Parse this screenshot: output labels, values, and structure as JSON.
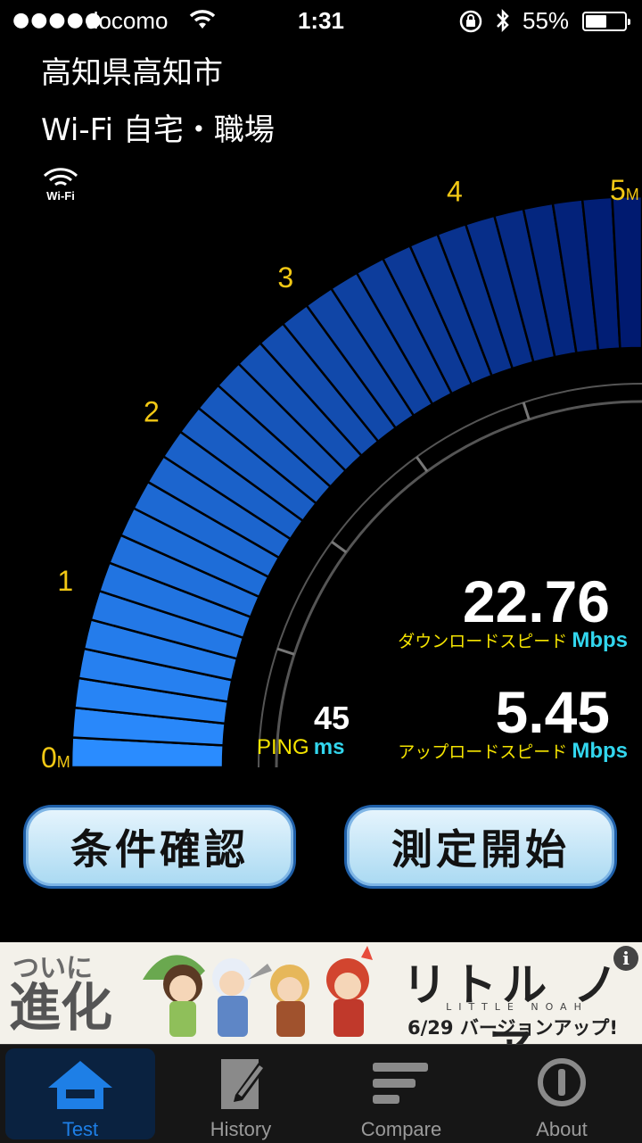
{
  "status_bar": {
    "carrier": "docomo",
    "signal_dots": "●●●●●",
    "time": "1:31",
    "battery_percent": "55%",
    "battery_level": 0.55
  },
  "location": "高知県高知市",
  "connection": "Wi-Fi 自宅・職場",
  "wifi_badge_label": "Wi-Fi",
  "gauge": {
    "scale_labels": [
      "0",
      "1",
      "2",
      "3",
      "4",
      "5"
    ],
    "unit_suffix": "M",
    "needle_value_mbps": 5,
    "max_mbps": 5,
    "color_light": "#2a8cff",
    "color_dark": "#001a70"
  },
  "results": {
    "download_value": "22.76",
    "download_label": "ダウンロードスピード",
    "download_unit": "Mbps",
    "upload_value": "5.45",
    "upload_label": "アップロードスピード",
    "upload_unit": "Mbps",
    "ping_value": "45",
    "ping_label": "PING",
    "ping_unit": "ms"
  },
  "buttons": {
    "conditions": "条件確認",
    "start": "測定開始"
  },
  "ad": {
    "left_small": "ついに",
    "left_big": "進化",
    "title": "リトル ノア",
    "subtitle": "LITTLE NOAH",
    "date_text": "6/29 バージョンアップ!",
    "info_icon": "i"
  },
  "tabs": [
    {
      "label": "Test",
      "icon": "home-icon",
      "active": true
    },
    {
      "label": "History",
      "icon": "notepad-icon",
      "active": false
    },
    {
      "label": "Compare",
      "icon": "lines-icon",
      "active": false
    },
    {
      "label": "About",
      "icon": "info-circle-icon",
      "active": false
    }
  ]
}
